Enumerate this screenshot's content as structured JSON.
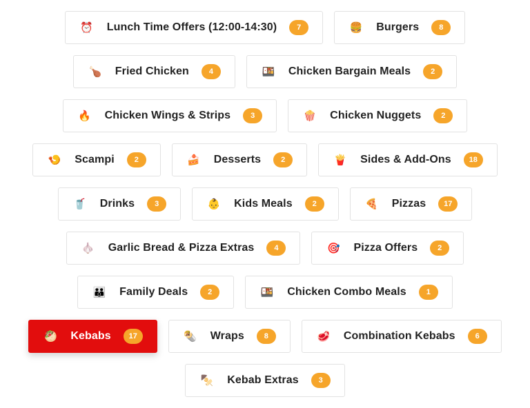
{
  "colors": {
    "accent": "#e20d0d",
    "badge": "#f6a52a",
    "border": "#e2e2e2",
    "text": "#222222"
  },
  "categories": [
    [
      {
        "icon": "alarm-clock-icon",
        "glyph": "⏰",
        "label": "Lunch Time Offers (12:00-14:30)",
        "count": "7"
      },
      {
        "icon": "burger-icon",
        "glyph": "🍔",
        "label": "Burgers",
        "count": "8"
      }
    ],
    [
      {
        "icon": "chicken-leg-icon",
        "glyph": "🍗",
        "label": "Fried Chicken",
        "count": "4"
      },
      {
        "icon": "bento-box-icon",
        "glyph": "🍱",
        "label": "Chicken Bargain Meals",
        "count": "2"
      }
    ],
    [
      {
        "icon": "fire-icon",
        "glyph": "🔥",
        "label": "Chicken Wings & Strips",
        "count": "3"
      },
      {
        "icon": "popcorn-icon",
        "glyph": "🍿",
        "label": "Chicken Nuggets",
        "count": "2"
      }
    ],
    [
      {
        "icon": "shrimp-icon",
        "glyph": "🍤",
        "label": "Scampi",
        "count": "2"
      },
      {
        "icon": "cake-slice-icon",
        "glyph": "🍰",
        "label": "Desserts",
        "count": "2"
      },
      {
        "icon": "fries-icon",
        "glyph": "🍟",
        "label": "Sides & Add-Ons",
        "count": "18"
      }
    ],
    [
      {
        "icon": "drink-cup-icon",
        "glyph": "🥤",
        "label": "Drinks",
        "count": "3"
      },
      {
        "icon": "baby-face-icon",
        "glyph": "👶",
        "label": "Kids Meals",
        "count": "2"
      },
      {
        "icon": "pizza-slice-icon",
        "glyph": "🍕",
        "label": "Pizzas",
        "count": "17"
      }
    ],
    [
      {
        "icon": "garlic-icon",
        "glyph": "🧄",
        "label": "Garlic Bread & Pizza Extras",
        "count": "4"
      },
      {
        "icon": "target-icon",
        "glyph": "🎯",
        "label": "Pizza Offers",
        "count": "2"
      }
    ],
    [
      {
        "icon": "family-icon",
        "glyph": "👪",
        "label": "Family Deals",
        "count": "2"
      },
      {
        "icon": "bento-box-icon",
        "glyph": "🍱",
        "label": "Chicken Combo Meals",
        "count": "1"
      }
    ],
    [
      {
        "icon": "kebab-icon",
        "glyph": "🥙",
        "label": "Kebabs",
        "count": "17",
        "active": true
      },
      {
        "icon": "wrap-icon",
        "glyph": "🌯",
        "label": "Wraps",
        "count": "8"
      },
      {
        "icon": "meat-icon",
        "glyph": "🥩",
        "label": "Combination Kebabs",
        "count": "6"
      }
    ],
    [
      {
        "icon": "skewer-icon",
        "glyph": "🍢",
        "label": "Kebab Extras",
        "count": "3"
      }
    ]
  ]
}
